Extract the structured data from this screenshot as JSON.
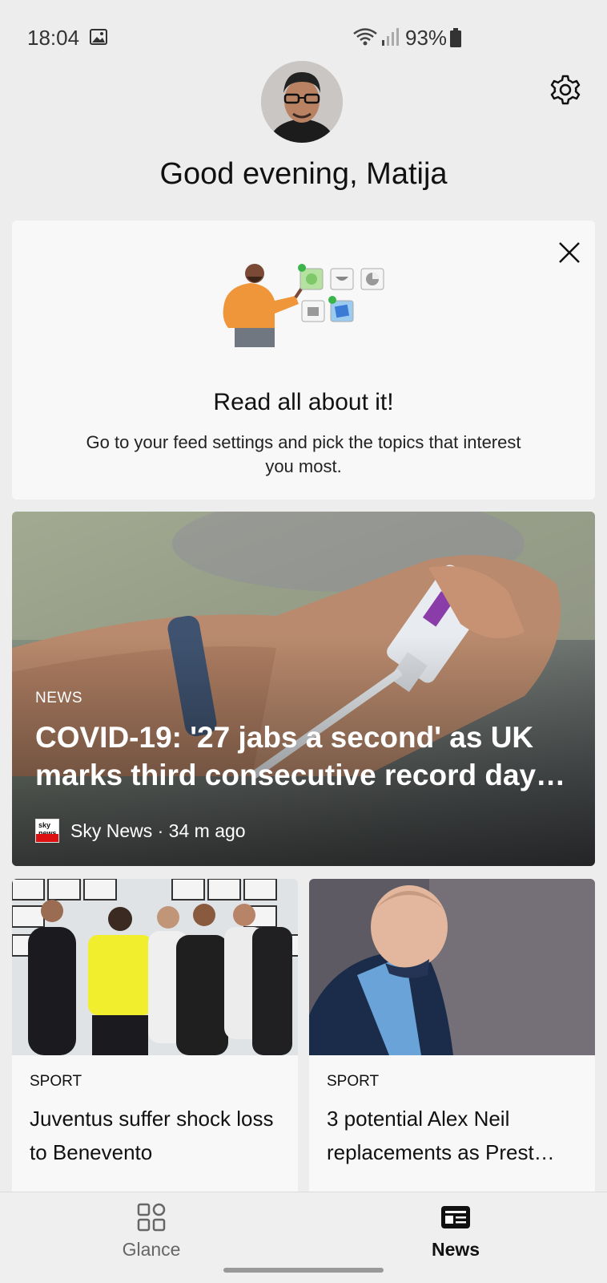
{
  "status_bar": {
    "time": "18:04",
    "battery": "93%"
  },
  "header": {
    "greeting": "Good evening, Matija"
  },
  "promo": {
    "title": "Read all about it!",
    "description": "Go to your feed settings and pick the topics that interest you most."
  },
  "hero": {
    "category": "NEWS",
    "title": "COVID-19: '27 jabs a second' as UK marks third consecutive record day…",
    "source": "Sky News · 34 m ago",
    "source_logo_text": "sky news"
  },
  "cards": [
    {
      "category": "SPORT",
      "title": "Juventus suffer shock loss to Benevento"
    },
    {
      "category": "SPORT",
      "title": "3 potential Alex Neil replacements as Prest…"
    }
  ],
  "bottom_nav": {
    "glance_label": "Glance",
    "news_label": "News",
    "active": "News"
  }
}
